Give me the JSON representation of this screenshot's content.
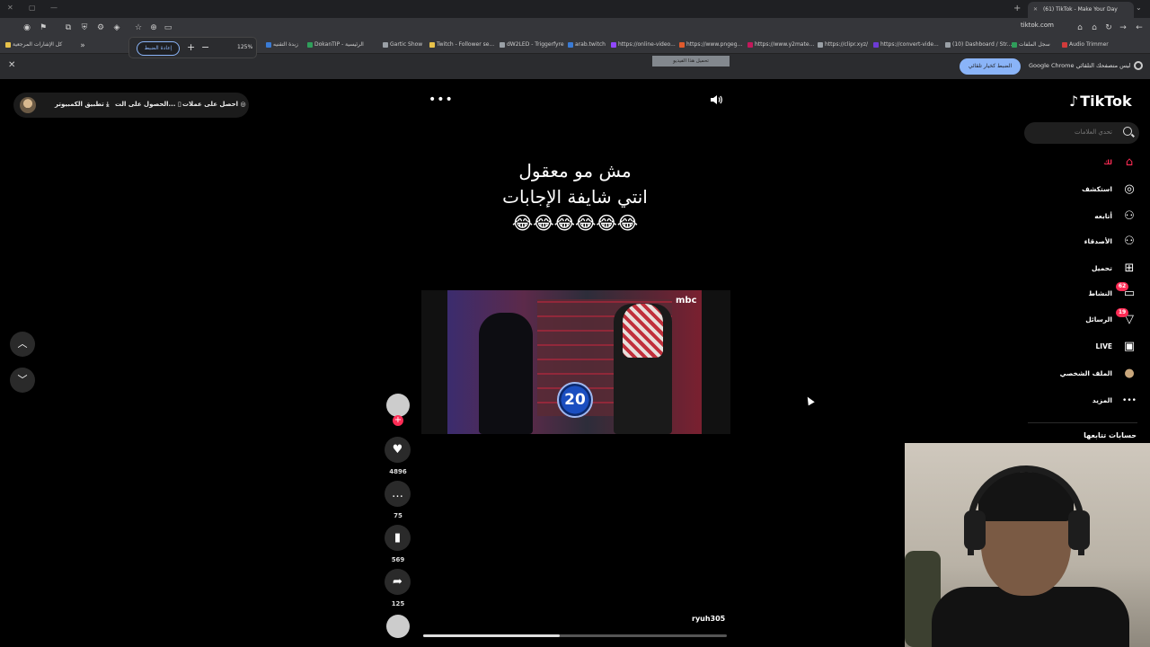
{
  "browser": {
    "tab_title": "(61) TikTok - Make Your Day",
    "url": "tiktok.com",
    "zoom": {
      "reset_label": "إعادة الضبط",
      "level": "125%",
      "plus": "+",
      "minus": "−"
    },
    "bookmarks": [
      {
        "label": "كل الإشارات المرجعية",
        "color": "#e8c24a"
      },
      {
        "label": "زبدة التقنيه",
        "color": "#3a7bd5"
      },
      {
        "label": "DokanTIP - الرئيسية",
        "color": "#2f9e5a"
      },
      {
        "label": "Gartic Show",
        "color": "#9aa0a6"
      },
      {
        "label": "Twitch - Follower se...",
        "color": "#e8c24a"
      },
      {
        "label": "dW2LED - Triggerfyre",
        "color": "#9aa0a6"
      },
      {
        "label": "arab.twitch",
        "color": "#3a7bd5"
      },
      {
        "label": "https://online-video...",
        "color": "#9147ff"
      },
      {
        "label": "https://www.pngeg...",
        "color": "#e05a2c"
      },
      {
        "label": "https://www.y2mate...",
        "color": "#c2185b"
      },
      {
        "label": "https://clipr.xyz/",
        "color": "#9aa0a6"
      },
      {
        "label": "https://convert-vide...",
        "color": "#6d3bd6"
      },
      {
        "label": "(10) Dashboard / Str...",
        "color": "#9aa0a6"
      },
      {
        "label": "سجل الملفات",
        "color": "#2f9e5a"
      },
      {
        "label": "Audio Trimmer",
        "color": "#d23b3b"
      }
    ],
    "infobar": {
      "message": "Google Chrome ليس متصفحك التلقائي",
      "button": "الضبط كخيار تلقائي"
    },
    "download_hint": "تحميل هذا الفيديو"
  },
  "tiktok": {
    "logo": "TikTok",
    "search_placeholder": "تحدي العلامات",
    "top_pill": {
      "coins": "احصل على عملات",
      "get_app": "الحصول على الت...",
      "desktop_app": "تطبيق الكمبيوتر"
    },
    "nav": [
      {
        "label": "لك",
        "icon": "home-icon",
        "glyph": "⌂",
        "active": true,
        "badge": ""
      },
      {
        "label": "استكشف",
        "icon": "compass-icon",
        "glyph": "◎",
        "active": false,
        "badge": ""
      },
      {
        "label": "أتابعه",
        "icon": "following-icon",
        "glyph": "⚇",
        "active": false,
        "badge": ""
      },
      {
        "label": "الأصدقاء",
        "icon": "friends-icon",
        "glyph": "⚇",
        "active": false,
        "badge": ""
      },
      {
        "label": "تحميل",
        "icon": "upload-icon",
        "glyph": "⊞",
        "active": false,
        "badge": ""
      },
      {
        "label": "النشاط",
        "icon": "activity-icon",
        "glyph": "▭",
        "active": false,
        "badge": "62"
      },
      {
        "label": "الرسائل",
        "icon": "messages-icon",
        "glyph": "▽",
        "active": false,
        "badge": "19"
      },
      {
        "label": "LIVE",
        "icon": "live-icon",
        "glyph": "▣",
        "active": false,
        "badge": ""
      },
      {
        "label": "الملف الشخصي",
        "icon": "profile-avatar-icon",
        "glyph": "●",
        "active": false,
        "badge": ""
      },
      {
        "label": "المزيد",
        "icon": "more-icon",
        "glyph": "•••",
        "active": false,
        "badge": ""
      }
    ],
    "following_accounts_title": "حسابات تتابعها",
    "video": {
      "caption_line1": "مش مو معقول",
      "caption_line2": "انتي شايفة الإجابات",
      "caption_line3": "😂😂😂😂😂😂",
      "overlay_number": "20",
      "channel_mark": "mbc",
      "author": "ryuh305",
      "progress": 0.45
    },
    "actions": {
      "likes": "4896",
      "comments": "75",
      "saves": "569",
      "shares": "125"
    }
  }
}
